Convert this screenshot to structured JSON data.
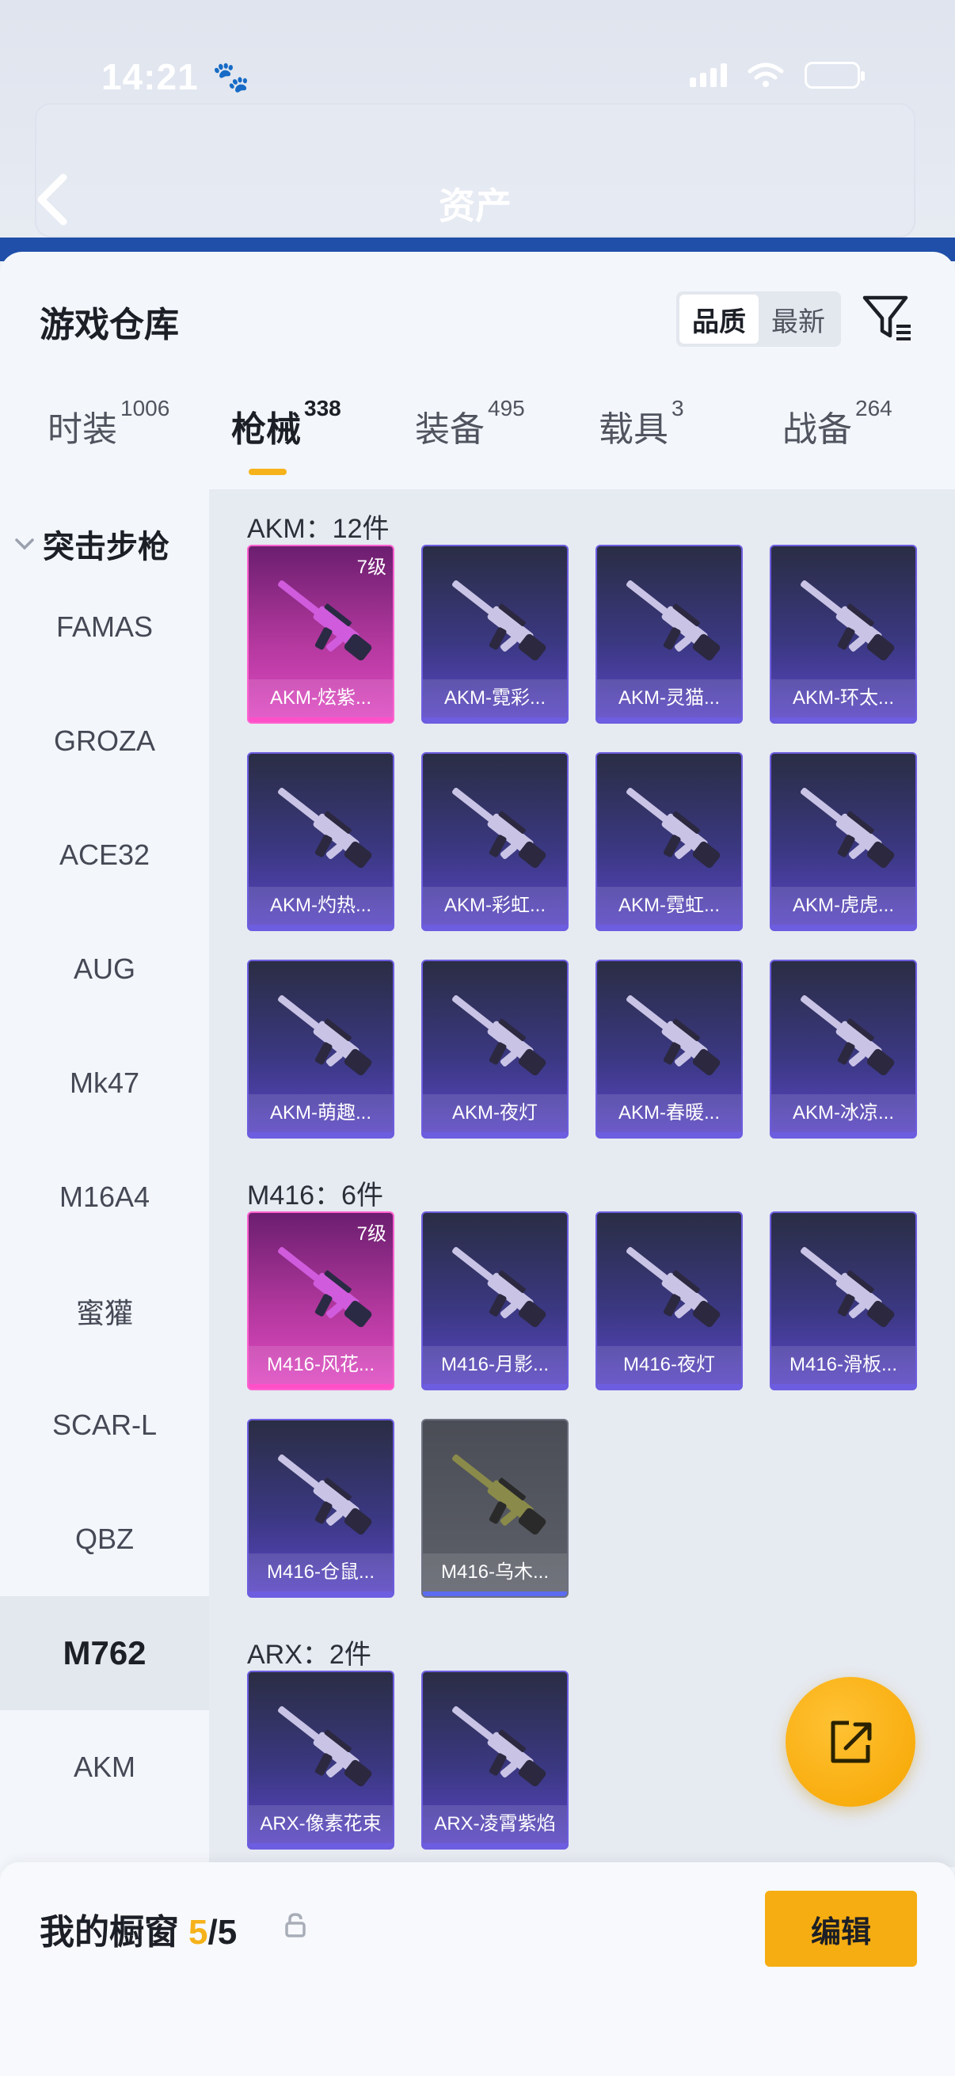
{
  "status_bar": {
    "time": "14:21"
  },
  "header": {
    "title": "资产"
  },
  "panel": {
    "title": "游戏仓库",
    "sort": {
      "options": [
        "品质",
        "最新"
      ],
      "selected": "品质"
    }
  },
  "tabs": [
    {
      "label": "时装",
      "count": "1006"
    },
    {
      "label": "枪械",
      "count": "338"
    },
    {
      "label": "装备",
      "count": "495"
    },
    {
      "label": "载具",
      "count": "3"
    },
    {
      "label": "战备",
      "count": "264"
    }
  ],
  "active_tab": "枪械",
  "sidenav": {
    "group": "突击步枪",
    "items": [
      "FAMAS",
      "GROZA",
      "ACE32",
      "AUG",
      "Mk47",
      "M16A4",
      "蜜獾",
      "SCAR-L",
      "QBZ",
      "M762",
      "AKM"
    ],
    "selected": "M762"
  },
  "sections": [
    {
      "title": "AKM：12件",
      "items": [
        {
          "name": "AKM-炫紫...",
          "level": "7级",
          "rarity": "pink"
        },
        {
          "name": "AKM-霓彩...",
          "rarity": "purple"
        },
        {
          "name": "AKM-灵猫...",
          "rarity": "purple"
        },
        {
          "name": "AKM-环太...",
          "rarity": "purple"
        },
        {
          "name": "AKM-灼热...",
          "rarity": "purple"
        },
        {
          "name": "AKM-彩虹...",
          "rarity": "purple"
        },
        {
          "name": "AKM-霓虹...",
          "rarity": "purple"
        },
        {
          "name": "AKM-虎虎...",
          "rarity": "purple"
        },
        {
          "name": "AKM-萌趣...",
          "rarity": "purple"
        },
        {
          "name": "AKM-夜灯",
          "rarity": "purple"
        },
        {
          "name": "AKM-春暖...",
          "rarity": "purple"
        },
        {
          "name": "AKM-冰凉...",
          "rarity": "purple"
        }
      ]
    },
    {
      "title": "M416：6件",
      "items": [
        {
          "name": "M416-风花...",
          "level": "7级",
          "rarity": "pink"
        },
        {
          "name": "M416-月影...",
          "rarity": "purple"
        },
        {
          "name": "M416-夜灯",
          "rarity": "purple"
        },
        {
          "name": "M416-滑板...",
          "rarity": "purple"
        },
        {
          "name": "M416-仓鼠...",
          "rarity": "purple"
        },
        {
          "name": "M416-乌木...",
          "rarity": "grey"
        }
      ]
    },
    {
      "title": "ARX：2件",
      "items": [
        {
          "name": "ARX-像素花束",
          "rarity": "purple"
        },
        {
          "name": "ARX-凌霄紫焰",
          "rarity": "purple"
        }
      ]
    }
  ],
  "showcase": {
    "label": "我的橱窗",
    "current": "5",
    "total": "/5",
    "edit_label": "编辑"
  },
  "colors": {
    "accent": "#f6ad12",
    "purple_card": "#5a45c6",
    "pink_card": "#e04ac3",
    "grey_card": "#5e616a"
  },
  "icons": [
    "back-arrow-icon",
    "paw-icon",
    "signal-icon",
    "wifi-icon",
    "battery-icon",
    "filter-icon",
    "chevron-down-icon",
    "gun-icon",
    "share-icon",
    "lock-icon"
  ]
}
